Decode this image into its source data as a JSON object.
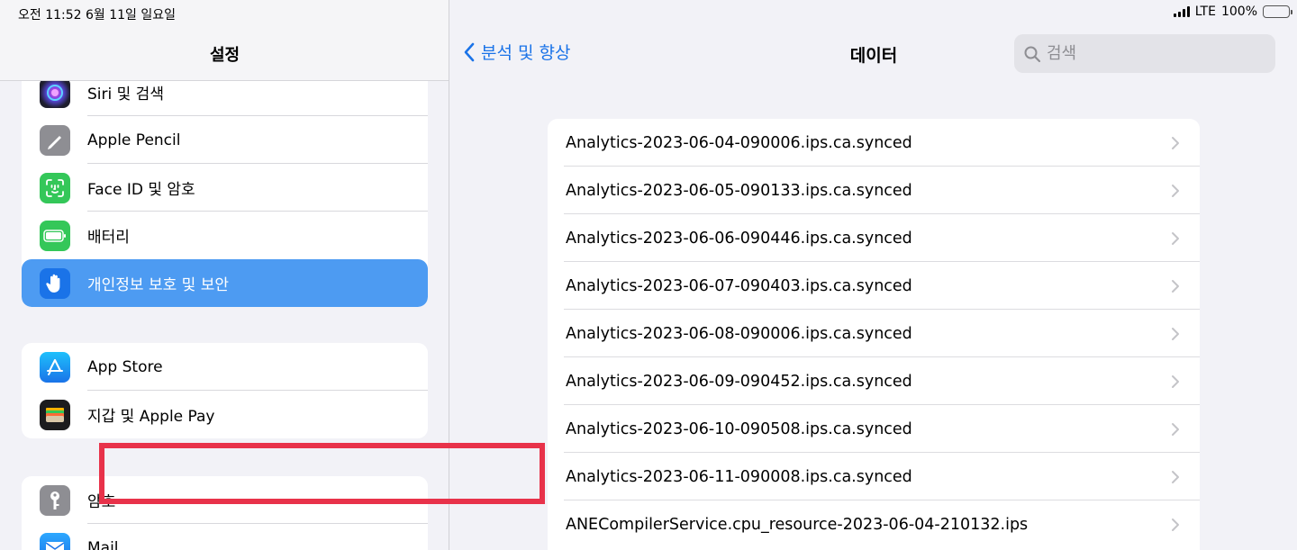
{
  "status_bar": {
    "time_date": "오전 11:52   6월 11일 일요일",
    "network": "LTE",
    "battery": "100%"
  },
  "sidebar": {
    "title": "설정",
    "group1": [
      {
        "label": "Siri 및 검색",
        "icon": "siri-icon"
      },
      {
        "label": "Apple Pencil",
        "icon": "pencil-icon"
      },
      {
        "label": "Face ID 및 암호",
        "icon": "face-id-icon"
      },
      {
        "label": "배터리",
        "icon": "battery-icon"
      },
      {
        "label": "개인정보 보호 및 보안",
        "icon": "hand-icon",
        "selected": true
      }
    ],
    "group2": [
      {
        "label": "App Store",
        "icon": "app-store-icon"
      },
      {
        "label": "지갑 및 Apple Pay",
        "icon": "wallet-icon"
      }
    ],
    "group3": [
      {
        "label": "암호",
        "icon": "key-icon"
      },
      {
        "label": "Mail",
        "icon": "mail-icon"
      }
    ]
  },
  "detail": {
    "back_label": "분석 및 향상",
    "title": "데이터",
    "search_placeholder": "검색",
    "files": [
      "Analytics-2023-06-04-090006.ips.ca.synced",
      "Analytics-2023-06-05-090133.ips.ca.synced",
      "Analytics-2023-06-06-090446.ips.ca.synced",
      "Analytics-2023-06-07-090403.ips.ca.synced",
      "Analytics-2023-06-08-090006.ips.ca.synced",
      "Analytics-2023-06-09-090452.ips.ca.synced",
      "Analytics-2023-06-10-090508.ips.ca.synced",
      "Analytics-2023-06-11-090008.ips.ca.synced",
      "ANECompilerService.cpu_resource-2023-06-04-210132.ips"
    ],
    "highlighted_file_index": 7
  },
  "colors": {
    "accent": "#1a73e8",
    "selected_row": "#4d9bf2",
    "highlight_border": "#e8324a"
  }
}
